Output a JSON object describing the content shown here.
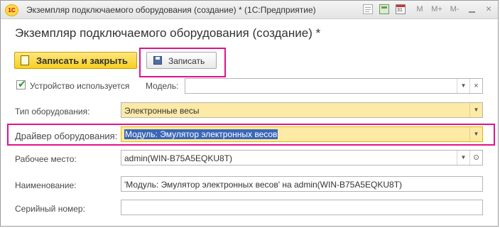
{
  "window": {
    "app_logo": "1С",
    "title": "Экземпляр подключаемого оборудования (создание) * (1С:Предприятие)",
    "toolbar": {
      "m_label": "M",
      "m_plus_label": "M+",
      "m_minus_label": "M-"
    },
    "icons": [
      "document-icon",
      "calculator-icon",
      "calendar-icon",
      "minimize-icon",
      "restore-icon",
      "close-icon"
    ],
    "calendar_day": "31"
  },
  "form": {
    "title": "Экземпляр подключаемого оборудования (создание) *",
    "buttons": {
      "save_close": "Записать и закрыть",
      "save": "Записать"
    },
    "device_used": {
      "label": "Устройство используется",
      "checked": true
    },
    "model": {
      "label": "Модель:",
      "value": ""
    },
    "equipment_type": {
      "label": "Тип оборудования:",
      "value": "Электронные весы"
    },
    "driver": {
      "label": "Драйвер оборудования:",
      "value": "Модуль: Эмулятор электронных весов"
    },
    "workplace": {
      "label": "Рабочее место:",
      "value": "admin(WIN-B75A5EQKU8T)"
    },
    "name": {
      "label": "Наименование:",
      "value": "'Модуль: Эмулятор электронных весов' на admin(WIN-B75A5EQKU8T)"
    },
    "serial": {
      "label": "Серийный номер:",
      "value": ""
    }
  },
  "colors": {
    "highlight": "#e0138c",
    "primary_button": "#f7cf1f",
    "required_field": "#fdeaa6",
    "selection": "#3a66b8"
  }
}
